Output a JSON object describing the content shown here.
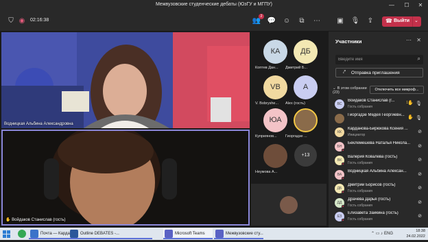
{
  "window": {
    "title": "Межвузовские студенческие дебаты (ЮзГУ и МГПУ)"
  },
  "toolbar": {
    "timer": "02:16:38",
    "participants_badge": "2",
    "leave_label": "Выйти"
  },
  "stage": {
    "main_video_1": {
      "name": "Водницкая Альбина Александровна"
    },
    "main_video_2": {
      "name": "Войдаков Станислав (гость)"
    },
    "tiles": [
      {
        "initials": "КА",
        "name": "Коптев Дан...",
        "color": "#c9d8e6"
      },
      {
        "initials": "ДБ",
        "name": "Дмитрий Б...",
        "color": "#f3e8b3"
      },
      {
        "initials": "VB",
        "name": "V. Bobryshe...",
        "color": "#f1d9a0"
      },
      {
        "initials": "A",
        "name": "Alex (гость)",
        "color": "#c9cdf1"
      },
      {
        "initials": "ЮА",
        "name": "Куприянов...",
        "color": "#f3c3c7"
      },
      {
        "initials": "",
        "name": "Гиоргадзе ...",
        "color": "#8a6b4a"
      },
      {
        "initials": "",
        "name": "Неумова А...",
        "color": "#6e4d3a"
      }
    ],
    "more_count": "+13"
  },
  "panel": {
    "title": "Участники",
    "search_placeholder": "Введите имя",
    "invite_label": "Отправка приглашения",
    "section_label": "В этом собрании",
    "section_count": "(23)",
    "mute_all_label": "Отключить все микроф...",
    "participants": [
      {
        "initials": "ВС",
        "name": "Войдаков Станислав (г...",
        "status": "Гость собрания",
        "color": "#c9cdf1",
        "hand_count": "1",
        "hand": true,
        "mic": "on",
        "dot": false
      },
      {
        "initials": "",
        "name": "Гиоргадзе Медея Георгиевн...",
        "status": "",
        "color": "#8a6b4a",
        "hand": true,
        "mic": "on",
        "dot": false
      },
      {
        "initials": "КК",
        "name": "Карданова-Бирюкова Ксения ...",
        "status": "Инициатор",
        "color": "#f1d9a0",
        "hand": false,
        "mic": "off",
        "dot": false
      },
      {
        "initials": "БН",
        "name": "Беклемешева Наталья Никола...",
        "status": "",
        "color": "#f3c3c7",
        "hand": false,
        "mic": "off",
        "dot": true
      },
      {
        "initials": "ВК",
        "name": "Валерия Ковалева (гость)",
        "status": "Гость собрания",
        "color": "#f3e8b3",
        "hand": false,
        "mic": "off",
        "dot": true
      },
      {
        "initials": "ВА",
        "name": "Водницкая Альбина Алексан...",
        "status": "",
        "color": "#f3c3c7",
        "hand": false,
        "mic": "off",
        "dot": true
      },
      {
        "initials": "ДБ",
        "name": "Дмитрий Борисов (гость)",
        "status": "Гость собрания",
        "color": "#f3e8b3",
        "hand": false,
        "mic": "off",
        "dot": true
      },
      {
        "initials": "ДД",
        "name": "Драчёва Дарья (гость)",
        "status": "Гость собрания",
        "color": "#d6e8c9",
        "hand": false,
        "mic": "off",
        "dot": true
      },
      {
        "initials": "ЕЗ",
        "name": "Елизавета Заикина (гость)",
        "status": "Гость собрания",
        "color": "#c9cdf1",
        "hand": false,
        "mic": "off",
        "dot": true
      }
    ]
  },
  "taskbar": {
    "apps": [
      {
        "label": "Почта — Кардано...",
        "active": false,
        "color": "#3b73c9"
      },
      {
        "label": "Outline DEBATES -...",
        "active": false,
        "color": "#2b579a"
      },
      {
        "label": "Microsoft Teams",
        "active": true,
        "color": "#5a62c4"
      },
      {
        "label": "Межвузовские сту...",
        "active": false,
        "color": "#5a62c4"
      }
    ],
    "lang": "ENG",
    "time": "18:38",
    "date": "24.02.2022"
  }
}
